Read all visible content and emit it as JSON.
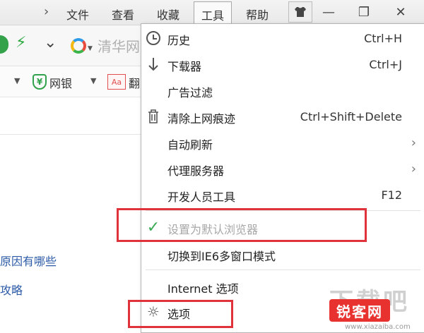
{
  "menubar": {
    "items": [
      "文件",
      "查看",
      "收藏",
      "工具",
      "帮助"
    ],
    "active": "工具"
  },
  "window_controls": {
    "skin": "shirt-icon",
    "minimize": "—",
    "restore": "❐",
    "close": "✕"
  },
  "addressbar": {
    "search_placeholder": "清华网"
  },
  "bookmarks": {
    "bank_label": "网银",
    "dict_badge": "Aa",
    "dict_label": "翻"
  },
  "page": {
    "links": [
      "原因有哪些",
      "攻略"
    ]
  },
  "dropdown": {
    "items": [
      {
        "label": "历史",
        "shortcut": "Ctrl+H",
        "icon": "clock-icon"
      },
      {
        "label": "下载器",
        "shortcut": "Ctrl+J",
        "icon": "download-arrow-icon"
      },
      {
        "label": "广告过滤",
        "shortcut": "",
        "icon": ""
      },
      {
        "label": "清除上网痕迹",
        "shortcut": "Ctrl+Shift+Delete",
        "icon": "trash-icon"
      },
      {
        "label": "自动刷新",
        "shortcut": "",
        "icon": "",
        "submenu": true
      },
      {
        "label": "代理服务器",
        "shortcut": "",
        "icon": "",
        "submenu": true
      },
      {
        "label": "开发人员工具",
        "shortcut": "F12",
        "icon": ""
      },
      {
        "label": "设置为默认浏览器",
        "shortcut": "",
        "icon": "check-icon",
        "disabled": true
      },
      {
        "label": "切换到IE6多窗口模式",
        "shortcut": "",
        "icon": ""
      },
      {
        "label": "Internet 选项",
        "shortcut": "",
        "icon": ""
      },
      {
        "label": "选项",
        "shortcut": "",
        "icon": "gear-icon"
      }
    ]
  },
  "watermark": {
    "big": "下载吧",
    "badge": "锐客网",
    "small": "www.xiazaiba.com"
  },
  "colors": {
    "highlight": "#e0323a",
    "check": "#3aaa55",
    "link": "#2b5aa6"
  }
}
